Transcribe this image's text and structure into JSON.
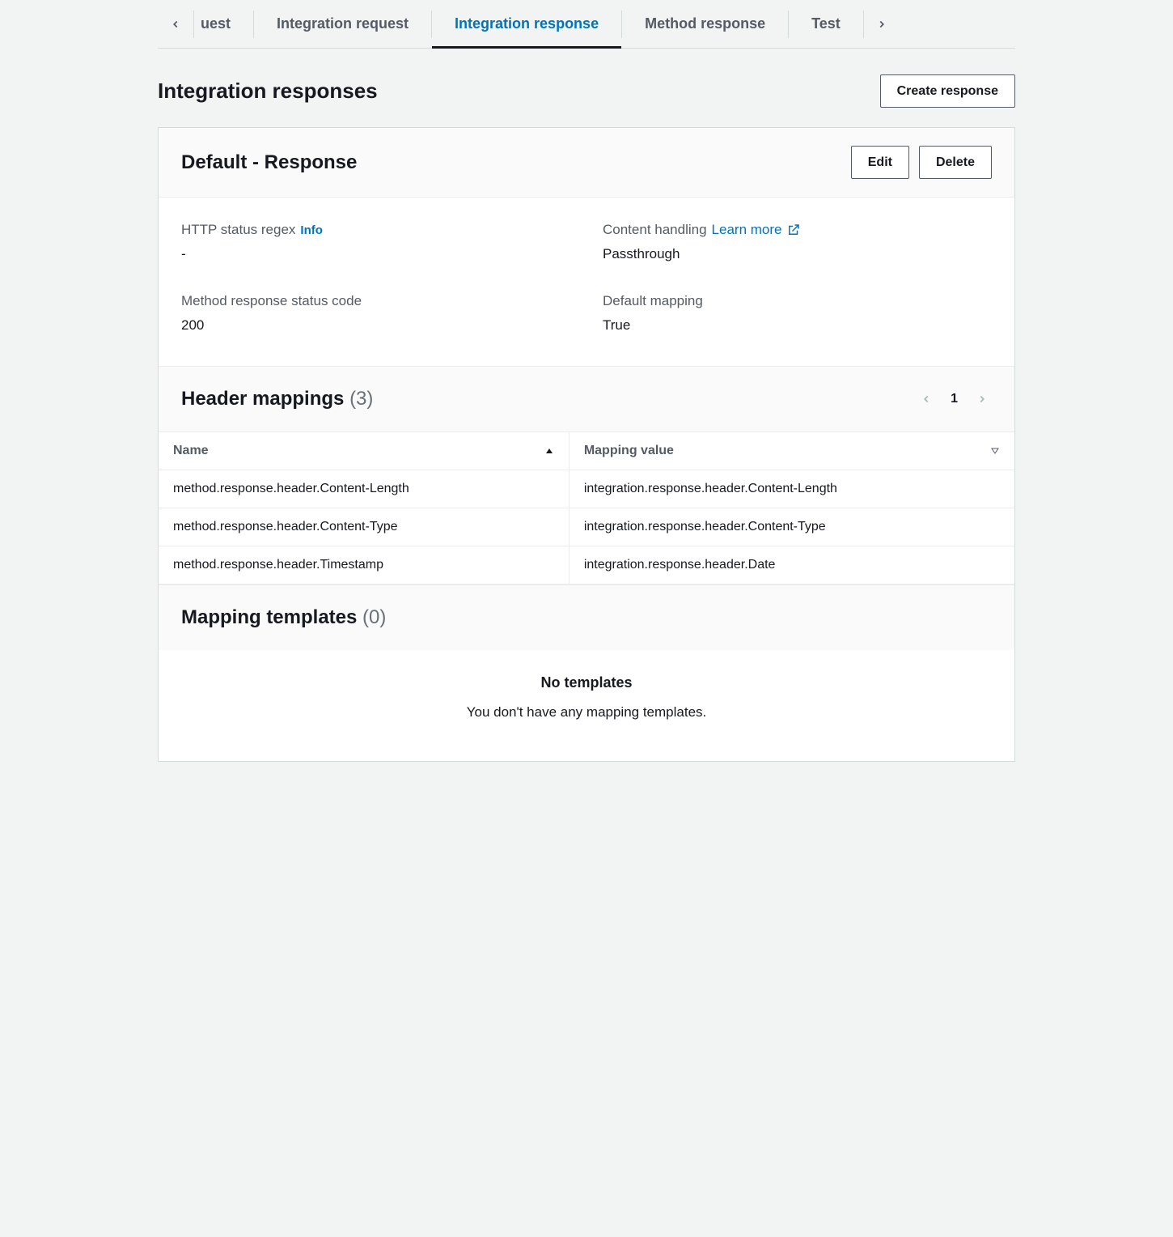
{
  "tabs": {
    "partial_left_label": "uest",
    "items": [
      {
        "label": "Integration request",
        "active": false
      },
      {
        "label": "Integration response",
        "active": true
      },
      {
        "label": "Method response",
        "active": false
      },
      {
        "label": "Test",
        "active": false
      }
    ]
  },
  "header": {
    "title": "Integration responses",
    "create_button": "Create response"
  },
  "panel": {
    "title": "Default - Response",
    "edit_label": "Edit",
    "delete_label": "Delete",
    "fields": {
      "http_status_regex": {
        "label": "HTTP status regex",
        "info_label": "Info",
        "value": "-"
      },
      "content_handling": {
        "label": "Content handling",
        "learn_more": "Learn more",
        "value": "Passthrough"
      },
      "method_response_status": {
        "label": "Method response status code",
        "value": "200"
      },
      "default_mapping": {
        "label": "Default mapping",
        "value": "True"
      }
    }
  },
  "header_mappings": {
    "title": "Header mappings",
    "count_display": "(3)",
    "pager_current": "1",
    "columns": {
      "name": "Name",
      "mapping_value": "Mapping value"
    },
    "rows": [
      {
        "name": "method.response.header.Content-Length",
        "value": "integration.response.header.Content-Length"
      },
      {
        "name": "method.response.header.Content-Type",
        "value": "integration.response.header.Content-Type"
      },
      {
        "name": "method.response.header.Timestamp",
        "value": "integration.response.header.Date"
      }
    ]
  },
  "mapping_templates": {
    "title": "Mapping templates",
    "count_display": "(0)",
    "empty_title": "No templates",
    "empty_sub": "You don't have any mapping templates."
  }
}
